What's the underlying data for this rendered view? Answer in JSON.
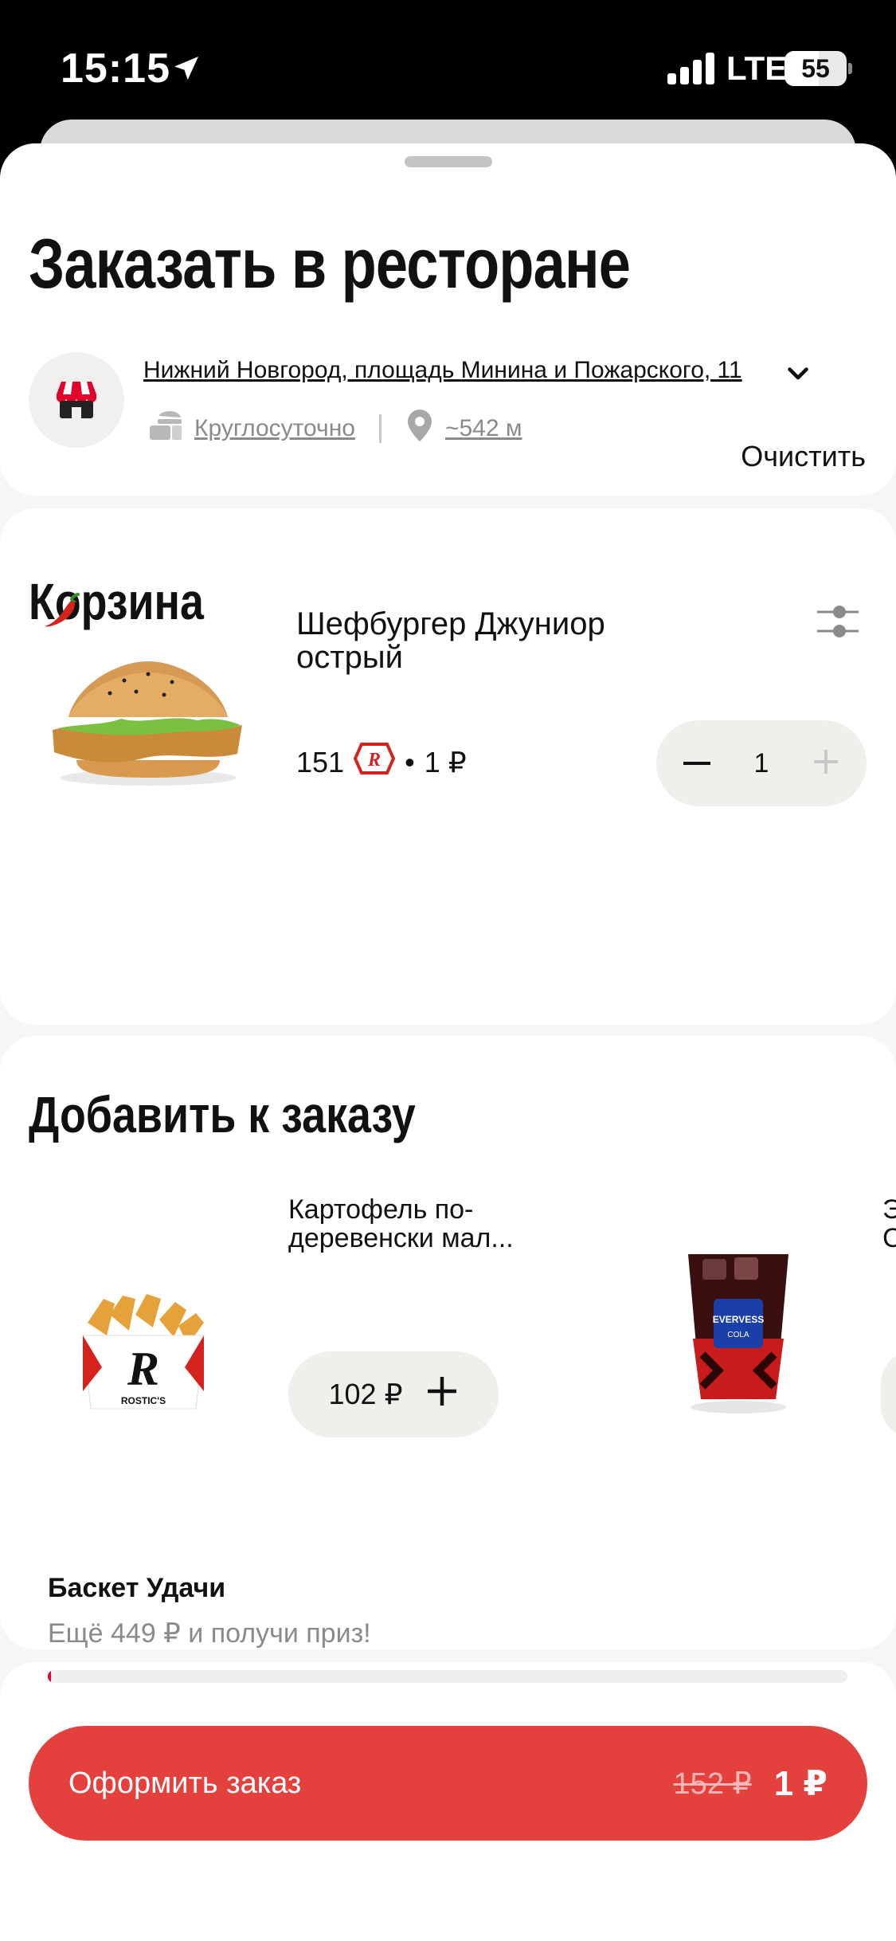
{
  "status_bar": {
    "time": "15:15",
    "network": "LTE",
    "battery": "55",
    "battery_level": 0.55
  },
  "header": {
    "title": "Заказать в ресторане"
  },
  "store": {
    "address": "Нижний Новгород, площадь Минина и Пожарского, 11",
    "hours": "Круглосуточно",
    "distance": "~542 м"
  },
  "cart": {
    "title": "Корзина",
    "clear_label": "Очистить",
    "item": {
      "name": "Шефбургер Джуниор острый",
      "points": "151",
      "separator": "•",
      "price": "1 ₽",
      "quantity": "1"
    }
  },
  "recommendations": {
    "title": "Добавить к заказу",
    "items": [
      {
        "name": "Картофель по-деревенски мал...",
        "price": "102 ₽"
      },
      {
        "name": "Э\nС"
      }
    ]
  },
  "promo": {
    "title": "Баскет Удачи",
    "subtitle": "Ещё 449 ₽ и получи приз!",
    "progress": 0.004
  },
  "checkout": {
    "label": "Оформить заказ",
    "old_price": "152 ₽",
    "new_price": "1 ₽"
  },
  "colors": {
    "accent": "#e4403e",
    "brand_red": "#e4002b",
    "pill_bg": "#f1efec"
  }
}
